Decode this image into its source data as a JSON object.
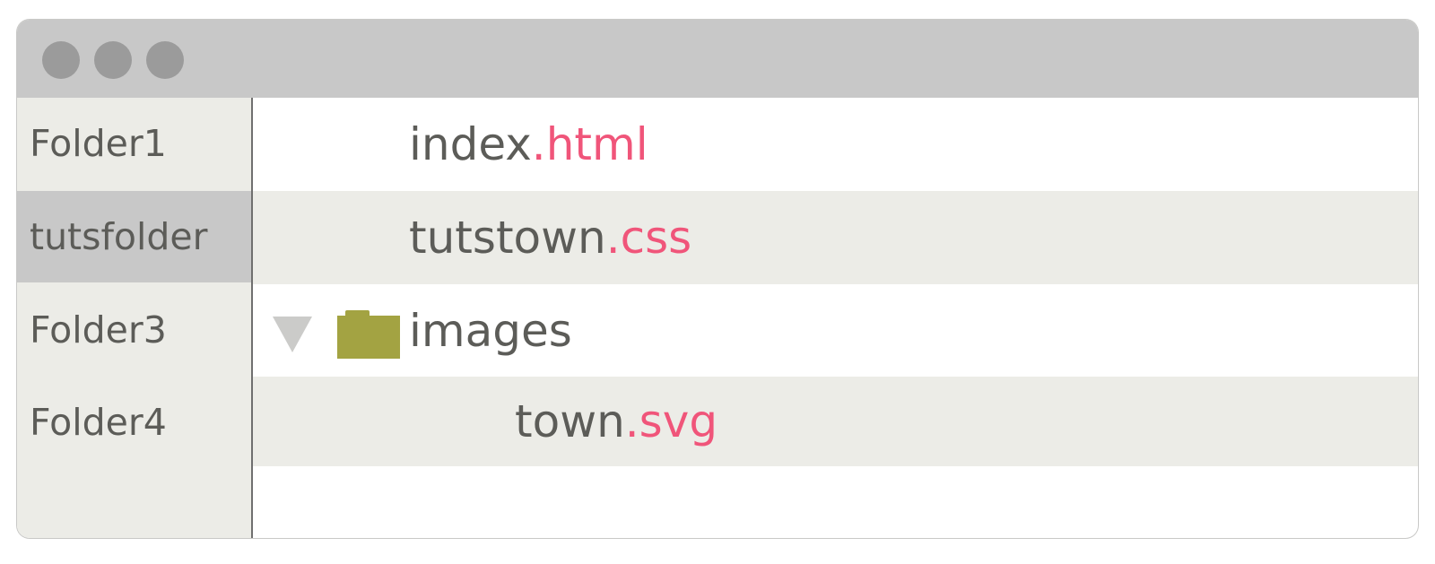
{
  "window": {
    "controls": [
      "close-dot",
      "minimize-dot",
      "zoom-dot"
    ]
  },
  "sidebar": {
    "items": [
      {
        "label": "Folder1",
        "selected": false
      },
      {
        "label": "tutsfolder",
        "selected": true
      },
      {
        "label": "Folder3",
        "selected": false
      },
      {
        "label": "Folder4",
        "selected": false
      }
    ]
  },
  "files": [
    {
      "name": "index",
      "ext": ".html"
    },
    {
      "name": "tutstown",
      "ext": ".css"
    },
    {
      "name": "images",
      "ext": "",
      "type": "folder",
      "expanded": true,
      "icons": [
        "triangle-down-icon",
        "folder-icon"
      ]
    },
    {
      "name": "town",
      "ext": ".svg",
      "parent": "images"
    }
  ],
  "colors": {
    "extension": "#f0557a",
    "folder": "#a3a342",
    "selected": "#c8c8c8",
    "alt_row": "#ecece7"
  }
}
